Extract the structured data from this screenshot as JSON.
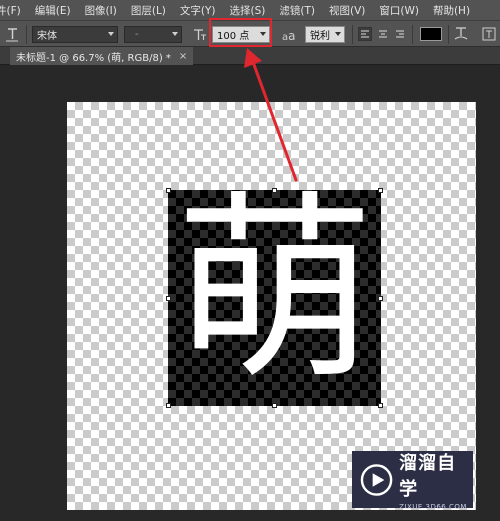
{
  "menu": [
    {
      "label": "件(F)"
    },
    {
      "label": "编辑(E)"
    },
    {
      "label": "图像(I)"
    },
    {
      "label": "图层(L)"
    },
    {
      "label": "文字(Y)"
    },
    {
      "label": "选择(S)"
    },
    {
      "label": "滤镜(T)"
    },
    {
      "label": "视图(V)"
    },
    {
      "label": "窗口(W)"
    },
    {
      "label": "帮助(H)"
    }
  ],
  "options": {
    "font_family": "宋体",
    "font_style": "-",
    "font_size": "100 点",
    "antialias_icon_text": "a",
    "antialias_icon_text_big": "a",
    "antialias": "锐利",
    "text_color": "#000000"
  },
  "document_tab": {
    "title": "未标题-1 @ 66.7% (萌, RGB/8) *",
    "close": "×"
  },
  "canvas": {
    "text": "萌"
  },
  "annotation": {
    "color": "#e0262e"
  },
  "watermark": {
    "title": "溜溜自学",
    "subtitle": "ZIXUE.3D66.COM"
  }
}
